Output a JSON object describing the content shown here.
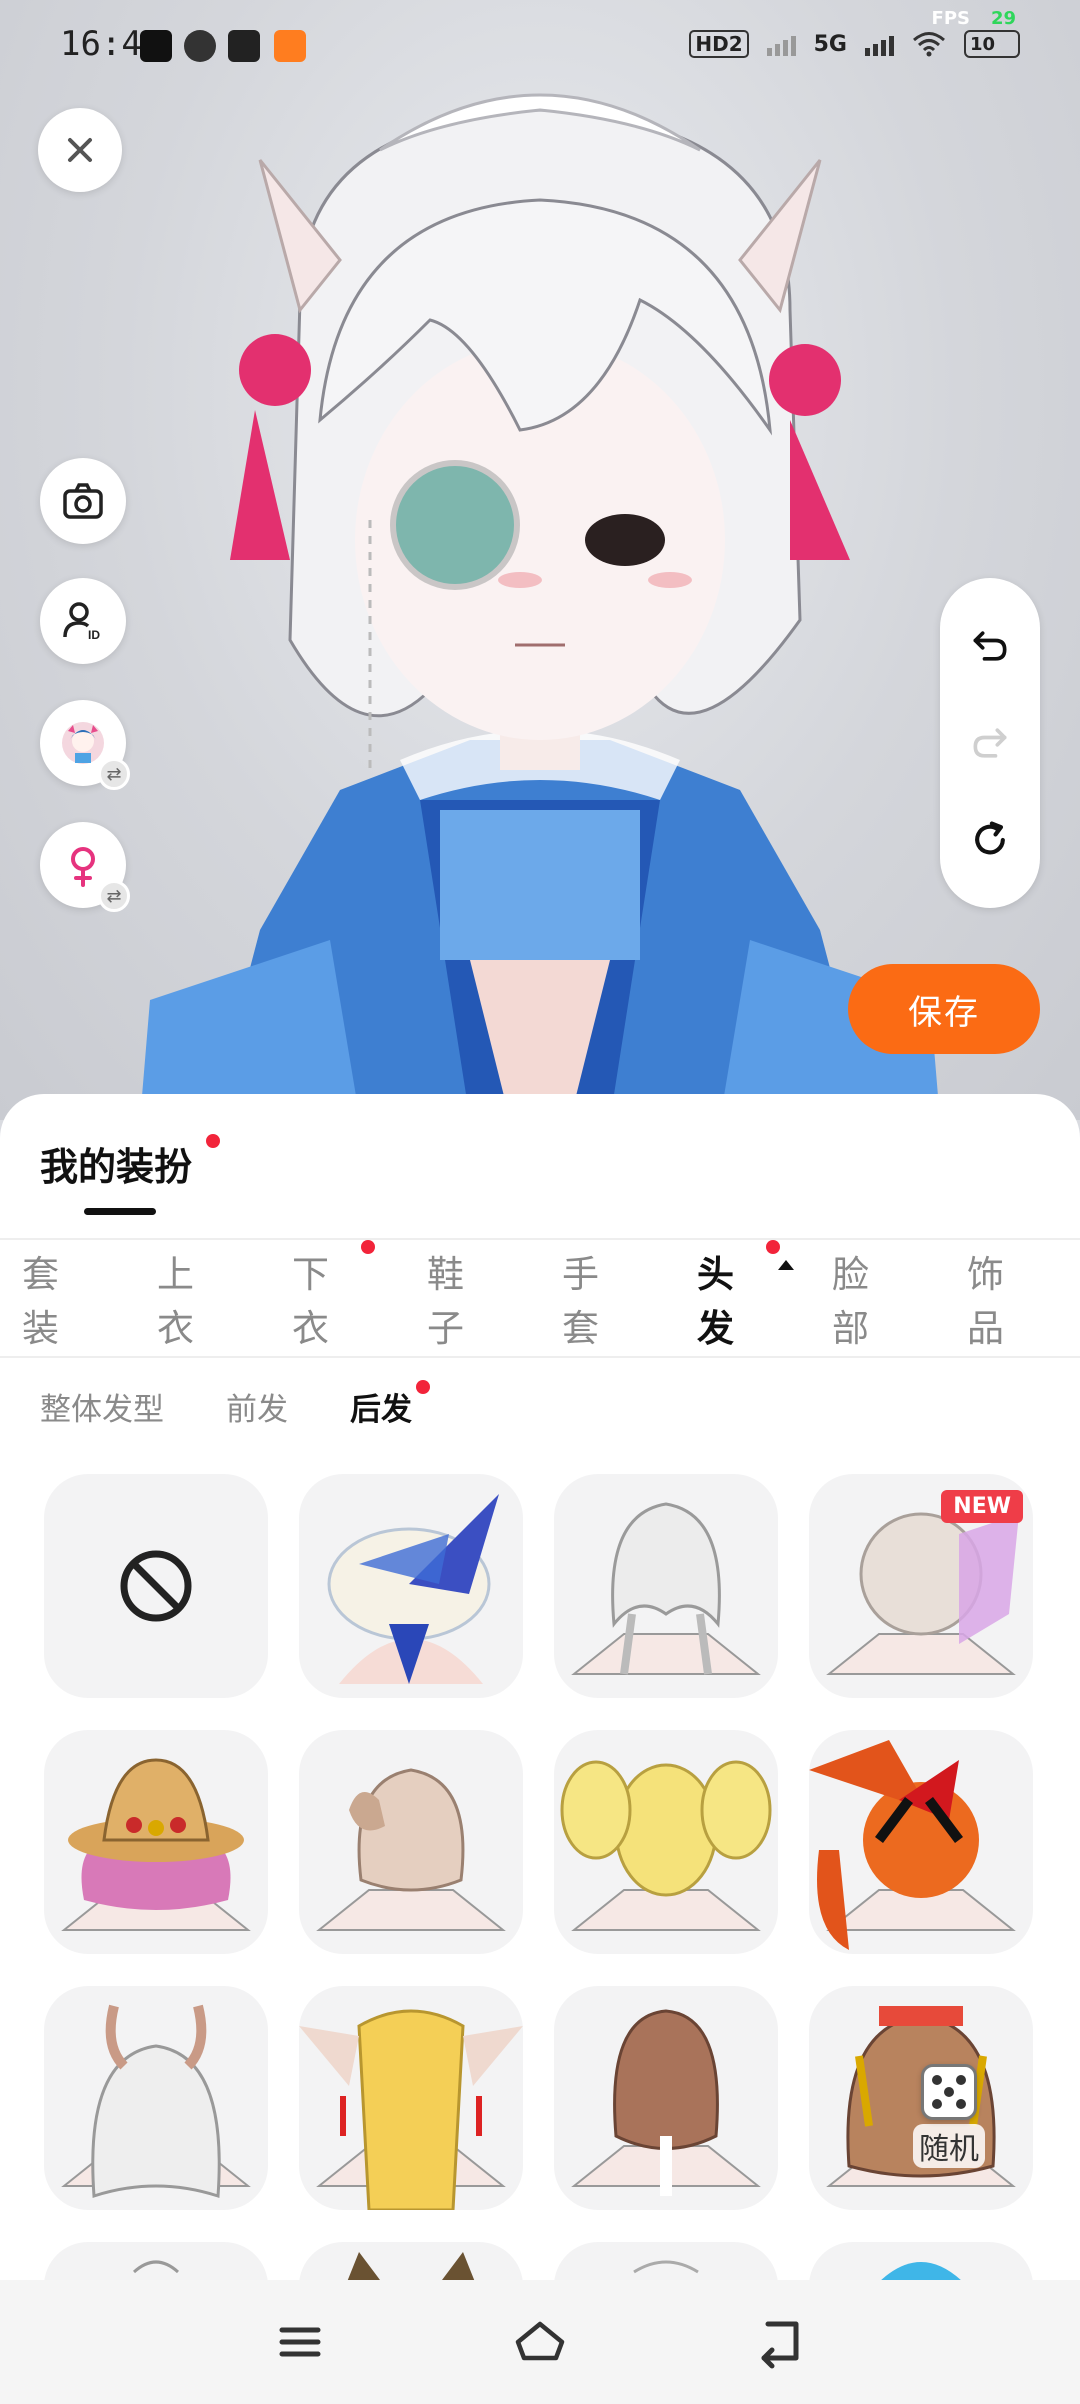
{
  "status_bar": {
    "time": "16:45",
    "network_hd": "HD2",
    "network_5g": "5G",
    "battery": "10",
    "fps_label": "FPS",
    "fps_value": "29"
  },
  "left_tools": {
    "close": "close",
    "camera": "camera",
    "profile_id": "profile-id",
    "avatar_switch": "avatar-switch",
    "gender_switch": "gender-switch"
  },
  "save_label": "保存",
  "sheet": {
    "title": "我的装扮",
    "categories": [
      {
        "label": "套装",
        "active": false,
        "dot": false
      },
      {
        "label": "上衣",
        "active": false,
        "dot": false
      },
      {
        "label": "下衣",
        "active": false,
        "dot": true
      },
      {
        "label": "鞋子",
        "active": false,
        "dot": false
      },
      {
        "label": "手套",
        "active": false,
        "dot": false
      },
      {
        "label": "头发",
        "active": true,
        "dot": true
      },
      {
        "label": "脸部",
        "active": false,
        "dot": false
      },
      {
        "label": "饰品",
        "active": false,
        "dot": false
      }
    ],
    "sub_tabs": [
      {
        "label": "整体发型",
        "active": false,
        "dot": false
      },
      {
        "label": "前发",
        "active": false,
        "dot": false
      },
      {
        "label": "后发",
        "active": true,
        "dot": true
      }
    ],
    "new_badge": "NEW",
    "random_label": "随机"
  },
  "colors": {
    "accent": "#fb6b14",
    "red_dot": "#f2243a",
    "new_badge": "#ef3d48"
  }
}
